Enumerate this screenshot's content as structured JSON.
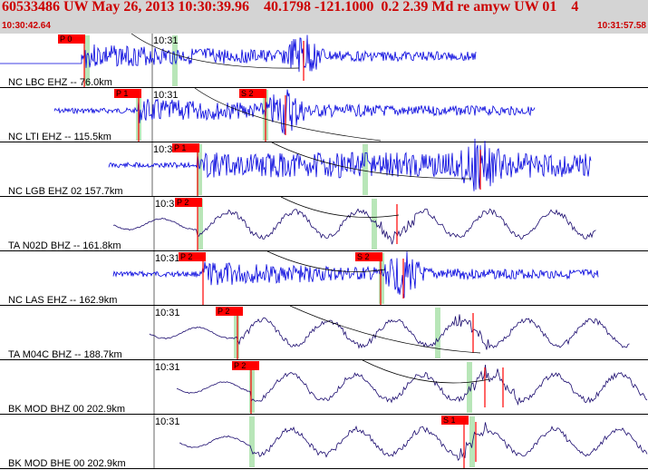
{
  "header": {
    "title": "60533486 UW May 26, 2013 10:30:39.96    40.1798 -121.1000  0.2 2.39 Md re amyw UW 01    4",
    "left_time": "10:30:42.64",
    "right_time": "10:31:57.58"
  },
  "time_tick_label": "10:31",
  "colors": {
    "header_bg": "#d4d4d4",
    "header_text": "#cc0000",
    "vertical_trace": "#0000dd",
    "broadband_trace": "#1a0a6e",
    "pick": "#ff0000",
    "window_mark": "#b8e6b8"
  },
  "channels": [
    {
      "label": "NC LBC EHZ -- 76.0km",
      "type": "vertical",
      "picks": [
        "P 0"
      ],
      "seed": 3
    },
    {
      "label": "NC LTI EHZ -- 115.5km",
      "type": "vertical",
      "picks": [
        "P 1",
        "S 2"
      ],
      "seed": 7
    },
    {
      "label": "NC LGB EHZ 02 157.7km",
      "type": "vertical",
      "picks": [
        "P 1"
      ],
      "seed": 11
    },
    {
      "label": "TA N02D BHZ -- 161.8km",
      "type": "broadband",
      "picks": [
        "P 2"
      ],
      "seed": 13
    },
    {
      "label": "NC LAS EHZ -- 162.9km",
      "type": "vertical",
      "picks": [
        "P 2",
        "S 2"
      ],
      "seed": 17
    },
    {
      "label": "TA M04C BHZ -- 188.7km",
      "type": "broadband",
      "picks": [
        "P 2"
      ],
      "seed": 19
    },
    {
      "label": "BK MOD BHZ 00 202.9km",
      "type": "broadband",
      "picks": [
        "P 2"
      ],
      "seed": 23
    },
    {
      "label": "BK MOD BHE 00 202.9km",
      "type": "broadband",
      "picks": [
        "S 1"
      ],
      "seed": 29
    }
  ]
}
